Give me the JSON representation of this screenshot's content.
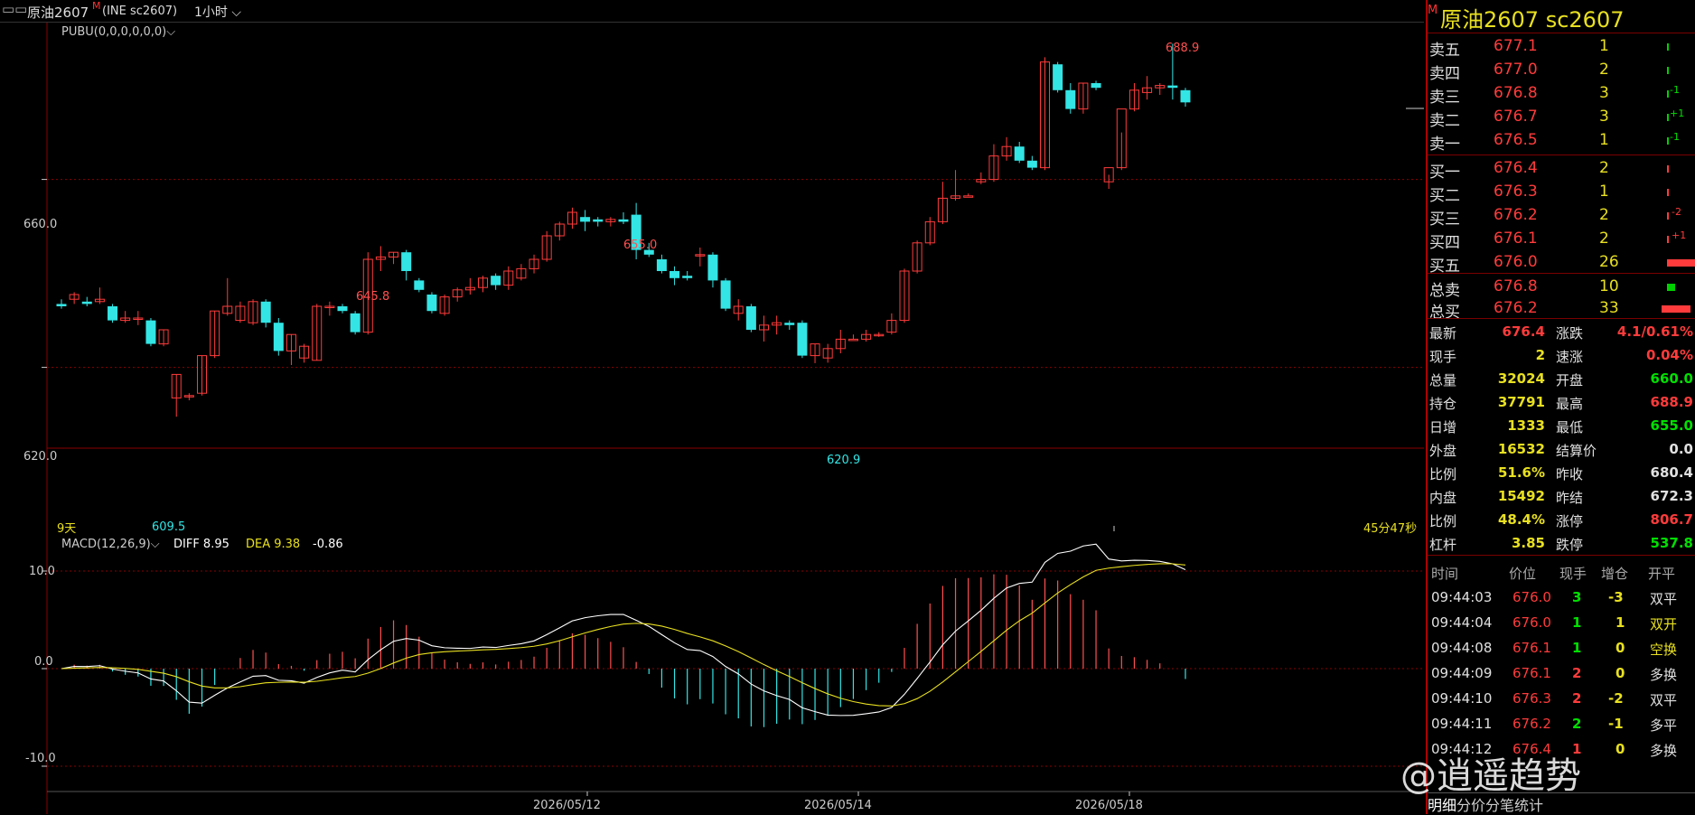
{
  "header": {
    "symbol": "原油2607",
    "modified_mark": "M",
    "exchange_code": "(INE sc2607)",
    "period": "1小时"
  },
  "chart": {
    "indicator_label": "PUBU(0,0,0,0,0,0)",
    "price_ticks": [
      "660.0",
      "620.0"
    ],
    "macd_ticks": [
      "10.0",
      "0.0",
      "-10.0"
    ],
    "macd_label": "MACD(12,26,9)",
    "diff_label": "DIFF 8.95",
    "dea_label": "DEA 9.38",
    "macd_value": "-0.86",
    "days_label": "9天",
    "time_left": "45分47秒",
    "date_labels": [
      "2026/05/12",
      "2026/05/14",
      "2026/05/18"
    ],
    "annotations": {
      "high1": "645.8",
      "high2": "655.0",
      "high3": "688.9",
      "low1": "609.5",
      "low2": "620.9"
    }
  },
  "chart_data": {
    "type": "candlestick",
    "ylim": [
      603,
      693
    ],
    "x_labels": [
      "2026/05/12",
      "2026/05/14",
      "2026/05/18"
    ],
    "candles": [
      [
        633.5,
        634.5,
        632.5,
        633.0
      ],
      [
        634.5,
        636.0,
        633.5,
        635.5
      ],
      [
        634.0,
        635.0,
        633.0,
        633.5
      ],
      [
        634.0,
        637.0,
        633.5,
        634.5
      ],
      [
        633.0,
        633.5,
        629.5,
        630.0
      ],
      [
        630.0,
        632.0,
        629.5,
        630.5
      ],
      [
        630.5,
        632.0,
        629.0,
        630.5
      ],
      [
        630.0,
        630.5,
        624.5,
        625.0
      ],
      [
        625.0,
        628.0,
        624.5,
        628.0
      ],
      [
        613.5,
        618.5,
        609.5,
        618.5
      ],
      [
        614.0,
        614.5,
        613.0,
        614.0
      ],
      [
        614.5,
        622.5,
        614.0,
        622.5
      ],
      [
        622.5,
        632.0,
        622.0,
        632.0
      ],
      [
        631.5,
        639.0,
        631.0,
        633.0
      ],
      [
        630.0,
        634.0,
        629.5,
        633.0
      ],
      [
        629.5,
        634.5,
        629.0,
        634.0
      ],
      [
        634.0,
        634.5,
        628.5,
        629.5
      ],
      [
        629.5,
        630.5,
        622.5,
        623.5
      ],
      [
        623.5,
        627.0,
        620.5,
        627.0
      ],
      [
        622.0,
        625.0,
        621.0,
        624.5
      ],
      [
        621.5,
        633.5,
        621.5,
        633.0
      ],
      [
        633.0,
        634.0,
        631.0,
        633.0
      ],
      [
        633.0,
        633.5,
        631.5,
        632.0
      ],
      [
        631.5,
        632.0,
        627.0,
        627.5
      ],
      [
        627.5,
        644.5,
        627.0,
        643.0
      ],
      [
        643.0,
        645.8,
        640.5,
        643.5
      ],
      [
        643.5,
        644.5,
        642.0,
        644.5
      ],
      [
        644.5,
        645.0,
        638.5,
        640.5
      ],
      [
        638.5,
        639.0,
        636.0,
        636.5
      ],
      [
        635.5,
        636.0,
        631.5,
        632.0
      ],
      [
        631.5,
        635.5,
        631.0,
        635.0
      ],
      [
        635.0,
        637.0,
        634.0,
        636.5
      ],
      [
        636.5,
        639.0,
        635.5,
        637.0
      ],
      [
        637.0,
        639.5,
        636.0,
        639.0
      ],
      [
        639.5,
        640.0,
        636.5,
        637.5
      ],
      [
        637.5,
        641.5,
        636.5,
        640.5
      ],
      [
        639.0,
        642.0,
        638.5,
        641.0
      ],
      [
        641.0,
        644.0,
        640.0,
        643.0
      ],
      [
        643.0,
        649.0,
        642.5,
        648.0
      ],
      [
        648.0,
        651.0,
        647.0,
        650.5
      ],
      [
        650.5,
        654.0,
        649.5,
        653.0
      ],
      [
        652.0,
        653.5,
        649.0,
        651.0
      ],
      [
        651.5,
        652.0,
        650.0,
        651.0
      ],
      [
        651.0,
        652.0,
        650.0,
        651.5
      ],
      [
        651.5,
        653.0,
        650.5,
        651.0
      ],
      [
        652.5,
        655.0,
        643.0,
        645.0
      ],
      [
        645.0,
        646.5,
        643.5,
        644.0
      ],
      [
        643.0,
        644.0,
        640.0,
        640.5
      ],
      [
        640.5,
        641.5,
        637.5,
        639.0
      ],
      [
        639.5,
        640.5,
        638.5,
        639.0
      ],
      [
        644.0,
        645.5,
        641.5,
        644.0
      ],
      [
        644.0,
        644.5,
        637.0,
        638.5
      ],
      [
        638.5,
        639.0,
        632.0,
        632.5
      ],
      [
        631.5,
        634.5,
        630.0,
        633.0
      ],
      [
        633.0,
        633.5,
        627.5,
        628.0
      ],
      [
        628.0,
        631.0,
        625.5,
        629.0
      ],
      [
        629.0,
        631.0,
        627.0,
        629.5
      ],
      [
        629.5,
        630.0,
        628.0,
        629.0
      ],
      [
        629.5,
        630.0,
        622.0,
        622.5
      ],
      [
        622.5,
        625.0,
        620.9,
        625.0
      ],
      [
        622.0,
        625.0,
        621.0,
        624.0
      ],
      [
        624.0,
        628.0,
        623.0,
        626.0
      ],
      [
        626.0,
        627.0,
        626.0,
        626.0
      ],
      [
        626.0,
        628.0,
        625.5,
        627.0
      ],
      [
        627.0,
        627.5,
        626.5,
        627.0
      ],
      [
        627.5,
        631.5,
        627.0,
        630.0
      ],
      [
        630.0,
        641.0,
        629.5,
        640.5
      ],
      [
        640.5,
        647.0,
        640.0,
        646.5
      ],
      [
        646.5,
        652.0,
        646.0,
        651.0
      ],
      [
        651.0,
        659.5,
        650.5,
        656.0
      ],
      [
        656.0,
        662.0,
        655.5,
        656.5
      ],
      [
        656.5,
        657.0,
        656.5,
        656.5
      ],
      [
        659.5,
        661.5,
        659.0,
        660.0
      ],
      [
        660.0,
        667.5,
        659.5,
        665.0
      ],
      [
        665.0,
        669.0,
        664.0,
        667.0
      ],
      [
        667.0,
        668.0,
        663.5,
        664.0
      ],
      [
        664.0,
        665.0,
        662.0,
        662.5
      ],
      [
        662.5,
        686.0,
        662.0,
        685.0
      ],
      [
        684.5,
        685.0,
        678.5,
        679.0
      ],
      [
        679.0,
        680.5,
        674.0,
        675.0
      ],
      [
        675.0,
        680.5,
        674.0,
        680.5
      ],
      [
        680.5,
        681.0,
        679.0,
        679.5
      ],
      [
        659.5,
        661.0,
        658.0,
        662.5
      ],
      [
        662.5,
        670.0,
        662.0,
        675.0
      ],
      [
        675.0,
        680.5,
        674.5,
        679.0
      ],
      [
        678.5,
        682.0,
        677.0,
        679.5
      ],
      [
        679.5,
        680.5,
        678.0,
        680.0
      ],
      [
        680.0,
        688.9,
        677.0,
        679.5
      ],
      [
        679.0,
        679.5,
        675.5,
        676.4
      ]
    ]
  },
  "macd_data": {
    "ylim": [
      -12,
      13
    ],
    "note_series": "histogram, diff, dea approximated"
  },
  "panel": {
    "title": "原油2607  sc2607",
    "asks": [
      {
        "label": "卖五",
        "price": "677.1",
        "vol": "1",
        "delta": ""
      },
      {
        "label": "卖四",
        "price": "677.0",
        "vol": "2",
        "delta": ""
      },
      {
        "label": "卖三",
        "price": "676.8",
        "vol": "3",
        "delta": "-1"
      },
      {
        "label": "卖二",
        "price": "676.7",
        "vol": "3",
        "delta": "+1"
      },
      {
        "label": "卖一",
        "price": "676.5",
        "vol": "1",
        "delta": "-1"
      }
    ],
    "bids": [
      {
        "label": "买一",
        "price": "676.4",
        "vol": "2",
        "delta": ""
      },
      {
        "label": "买二",
        "price": "676.3",
        "vol": "1",
        "delta": ""
      },
      {
        "label": "买三",
        "price": "676.2",
        "vol": "2",
        "delta": "-2"
      },
      {
        "label": "买四",
        "price": "676.1",
        "vol": "2",
        "delta": "+1"
      },
      {
        "label": "买五",
        "price": "676.0",
        "vol": "26",
        "delta": "+1"
      }
    ],
    "totals": [
      {
        "label": "总卖",
        "price": "676.8",
        "vol": "10"
      },
      {
        "label": "总买",
        "price": "676.2",
        "vol": "33"
      }
    ],
    "stats": [
      {
        "l1": "最新",
        "v1": "676.4",
        "l2": "涨跌",
        "v2": "4.1/0.61%"
      },
      {
        "l1": "现手",
        "v1": "2",
        "l2": "速涨",
        "v2": "0.04%"
      },
      {
        "l1": "总量",
        "v1": "32024",
        "l2": "开盘",
        "v2": "660.0"
      },
      {
        "l1": "持仓",
        "v1": "37791",
        "l2": "最高",
        "v2": "688.9"
      },
      {
        "l1": "日增",
        "v1": "1333",
        "l2": "最低",
        "v2": "655.0"
      },
      {
        "l1": "外盘",
        "v1": "16532",
        "l2": "结算价",
        "v2": "0.0"
      },
      {
        "l1": "比例",
        "v1": "51.6%",
        "l2": "昨收",
        "v2": "680.4"
      },
      {
        "l1": "内盘",
        "v1": "15492",
        "l2": "昨结",
        "v2": "672.3"
      },
      {
        "l1": "比例",
        "v1": "48.4%",
        "l2": "涨停",
        "v2": "806.7"
      },
      {
        "l1": "杠杆",
        "v1": "3.85",
        "l2": "跌停",
        "v2": "537.8"
      }
    ],
    "trade_headers": [
      "时间",
      "价位",
      "现手",
      "增仓",
      "开平"
    ],
    "trades": [
      {
        "time": "09:44:03",
        "price": "676.0",
        "qty": "3",
        "oi": "-3",
        "type": "双平"
      },
      {
        "time": "09:44:04",
        "price": "676.0",
        "qty": "1",
        "oi": "1",
        "type": "双开"
      },
      {
        "time": "09:44:08",
        "price": "676.1",
        "qty": "1",
        "oi": "0",
        "type": "空换"
      },
      {
        "time": "09:44:09",
        "price": "676.1",
        "qty": "2",
        "oi": "0",
        "type": "多换"
      },
      {
        "time": "09:44:10",
        "price": "676.3",
        "qty": "2",
        "oi": "-2",
        "type": "双平"
      },
      {
        "time": "09:44:11",
        "price": "676.2",
        "qty": "2",
        "oi": "-1",
        "type": "多平"
      },
      {
        "time": "09:44:12",
        "price": "676.4",
        "qty": "1",
        "oi": "0",
        "type": "多换"
      }
    ],
    "tabs": [
      "明细",
      "分价",
      "分笔",
      "统计"
    ]
  },
  "watermark": "@逍遥趋势",
  "colors": {
    "up": "#ff3b3b",
    "down": "#33e5e5",
    "grid": "#8a0000",
    "panel_border": "#aa0000"
  }
}
